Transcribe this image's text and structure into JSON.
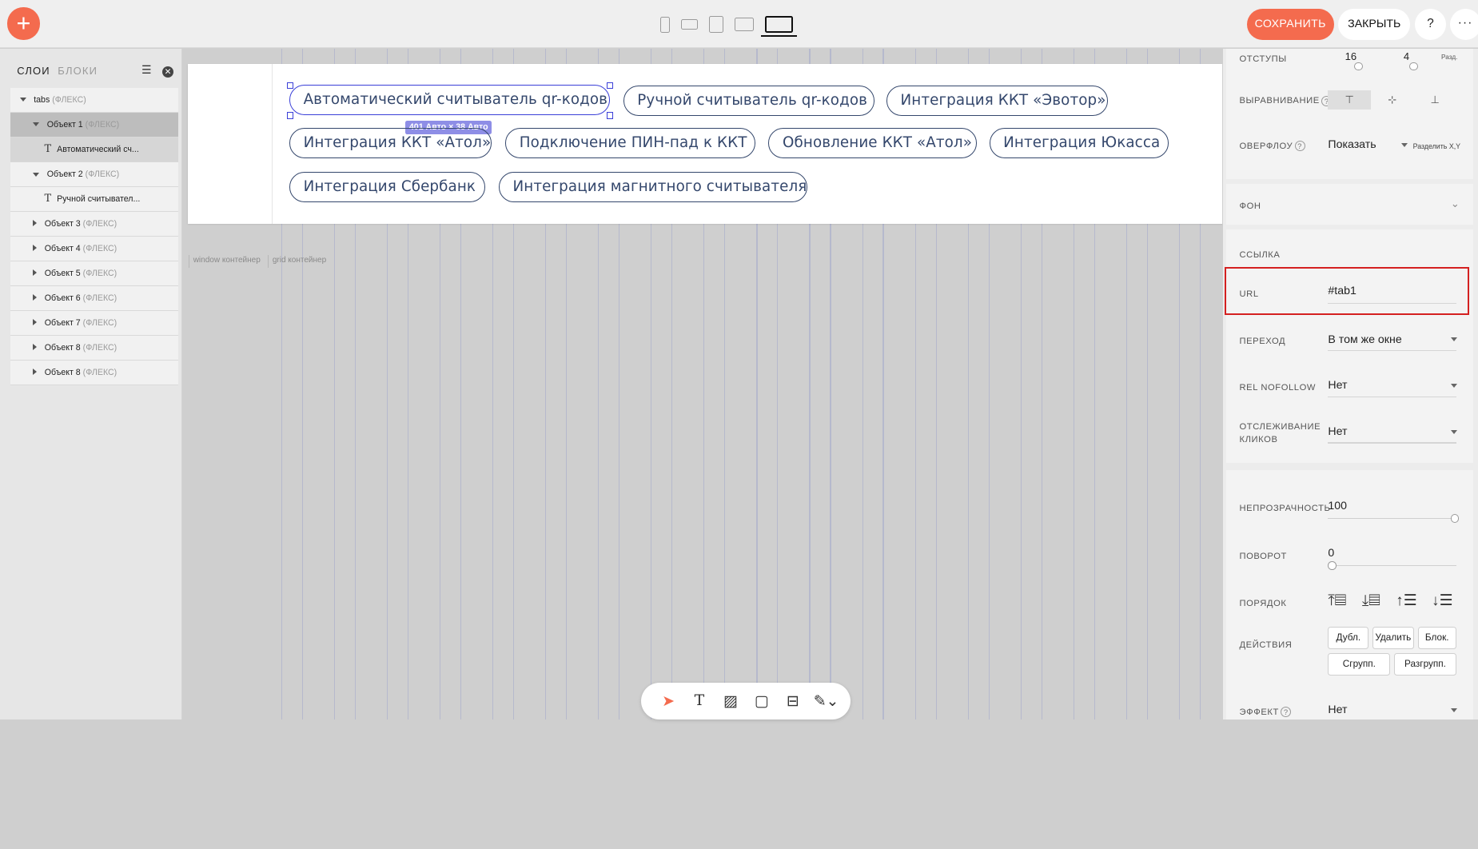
{
  "topbar": {
    "add_label": "+",
    "save_label": "СОХРАНИТЬ",
    "close_label": "ЗАКРЫТЬ",
    "help_label": "?",
    "more_label": "···",
    "devices": [
      "phone-portrait",
      "phone-landscape",
      "tablet-portrait",
      "tablet-landscape",
      "laptop"
    ]
  },
  "left_panel": {
    "tab_layers": "СЛОИ",
    "tab_blocks": "БЛОКИ",
    "layers": [
      {
        "name": "tabs",
        "sub": "(ФЛЕКС)"
      },
      {
        "name": "Объект 1",
        "sub": "(ФЛЕКС)"
      },
      {
        "name": "Автоматический сч..."
      },
      {
        "name": "Объект 2",
        "sub": "(ФЛЕКС)"
      },
      {
        "name": "Ручной считывател..."
      },
      {
        "name": "Объект 3",
        "sub": "(ФЛЕКС)"
      },
      {
        "name": "Объект 4",
        "sub": "(ФЛЕКС)"
      },
      {
        "name": "Объект 5",
        "sub": "(ФЛЕКС)"
      },
      {
        "name": "Объект 6",
        "sub": "(ФЛЕКС)"
      },
      {
        "name": "Объект 7",
        "sub": "(ФЛЕКС)"
      },
      {
        "name": "Объект 8",
        "sub": "(ФЛЕКС)"
      },
      {
        "name": "Объект 8",
        "sub": "(ФЛЕКС)"
      }
    ]
  },
  "canvas": {
    "tabs": [
      "Автоматический считыватель qr-кодов",
      "Ручной считыватель qr-кодов",
      "Интеграция ККТ «Эвотор»",
      "Интеграция ККТ «Атол»",
      "Подключение ПИН-пад к ККТ",
      "Обновление ККТ «Атол»",
      "Интеграция Юкасса",
      "Интеграция Сбербанк",
      "Интеграция магнитного считывателя"
    ],
    "size_tag": "401 Авто × 38 Авто",
    "window_container": "window контейнер",
    "grid_container": "grid контейнер"
  },
  "right_panel": {
    "padding_label": "ОТСТУПЫ",
    "padding_values": [
      "16",
      "4"
    ],
    "padding_split": "Разд.",
    "align_label": "ВЫРАВНИВАНИЕ",
    "overflow_label": "ОВЕРФЛОУ",
    "overflow_value": "Показать",
    "overflow_split": "Разделить X,Y",
    "bg_label": "ФОН",
    "link_section": "ССЫЛКА",
    "url_label": "URL",
    "url_value": "#tab1",
    "transition_label": "ПЕРЕХОД",
    "transition_value": "В том же окне",
    "nofollow_label": "REL NOFOLLOW",
    "nofollow_value": "Нет",
    "tracking_label_1": "ОТСЛЕЖИВАНИЕ",
    "tracking_label_2": "КЛИКОВ",
    "tracking_value": "Нет",
    "opacity_label": "НЕПРОЗРАЧНОСТЬ",
    "opacity_value": "100",
    "rotation_label": "ПОВОРОТ",
    "rotation_value": "0",
    "order_label": "ПОРЯДОК",
    "actions_label": "ДЕЙСТВИЯ",
    "btn_dup": "Дубл.",
    "btn_delete": "Удалить",
    "btn_block": "Блок.",
    "btn_group": "Сгрупп.",
    "btn_ungroup": "Разгрупп.",
    "effect_label": "ЭФФЕКТ",
    "effect_value": "Нет"
  },
  "colors": {
    "accent": "#f46b4e",
    "pill_border": "#34476c",
    "selection": "#3a3fd8",
    "highlight": "#d42020"
  }
}
